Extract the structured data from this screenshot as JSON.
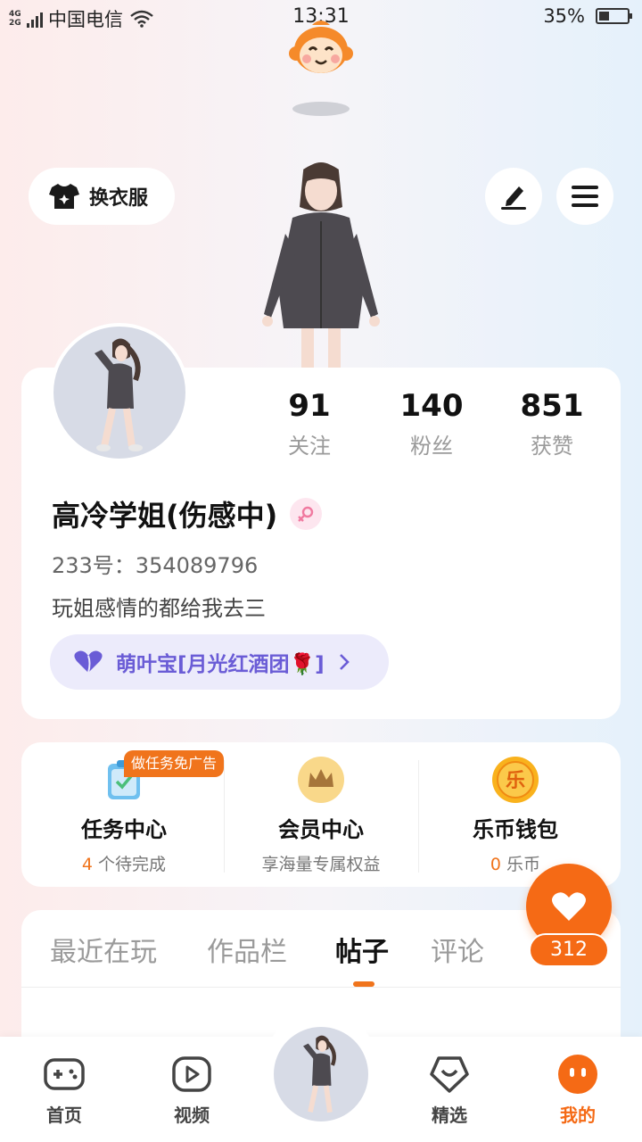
{
  "status_bar": {
    "network_top": "4G",
    "network_bottom": "2G",
    "carrier": "中国电信",
    "time": "13:31",
    "battery_pct": "35%",
    "battery_level": 0.35
  },
  "header": {
    "outfit_label": "换衣服",
    "edit_icon": "edit-icon",
    "menu_icon": "menu-icon"
  },
  "profile": {
    "stats": [
      {
        "value": "91",
        "label": "关注"
      },
      {
        "value": "140",
        "label": "粉丝"
      },
      {
        "value": "851",
        "label": "获赞"
      }
    ],
    "username": "高冷学姐(伤感中)",
    "gender": "female",
    "uid": "233号：354089796",
    "bio": "玩姐感情的都给我去三",
    "guild": "萌叶宝[月光红酒团🌹]"
  },
  "services": {
    "task_badge": "做任务免广告",
    "items": [
      {
        "title": "任务中心",
        "sub_value": "4",
        "sub_text": " 个待完成"
      },
      {
        "title": "会员中心",
        "sub_value": "",
        "sub_text": "享海量专属权益"
      },
      {
        "title": "乐币钱包",
        "sub_value": "0",
        "sub_text": " 乐币"
      }
    ]
  },
  "tabs": [
    {
      "label": "最近在玩"
    },
    {
      "label": "作品栏"
    },
    {
      "label": "帖子"
    },
    {
      "label": "评论"
    }
  ],
  "like": {
    "count": "312"
  },
  "bottom_nav": [
    {
      "label": "首页"
    },
    {
      "label": "视频"
    },
    {
      "label": "精选"
    },
    {
      "label": "我的"
    }
  ],
  "colors": {
    "accent": "#f56a15",
    "guild_text": "#6a5cd6",
    "guild_bg": "#ecebfb"
  }
}
